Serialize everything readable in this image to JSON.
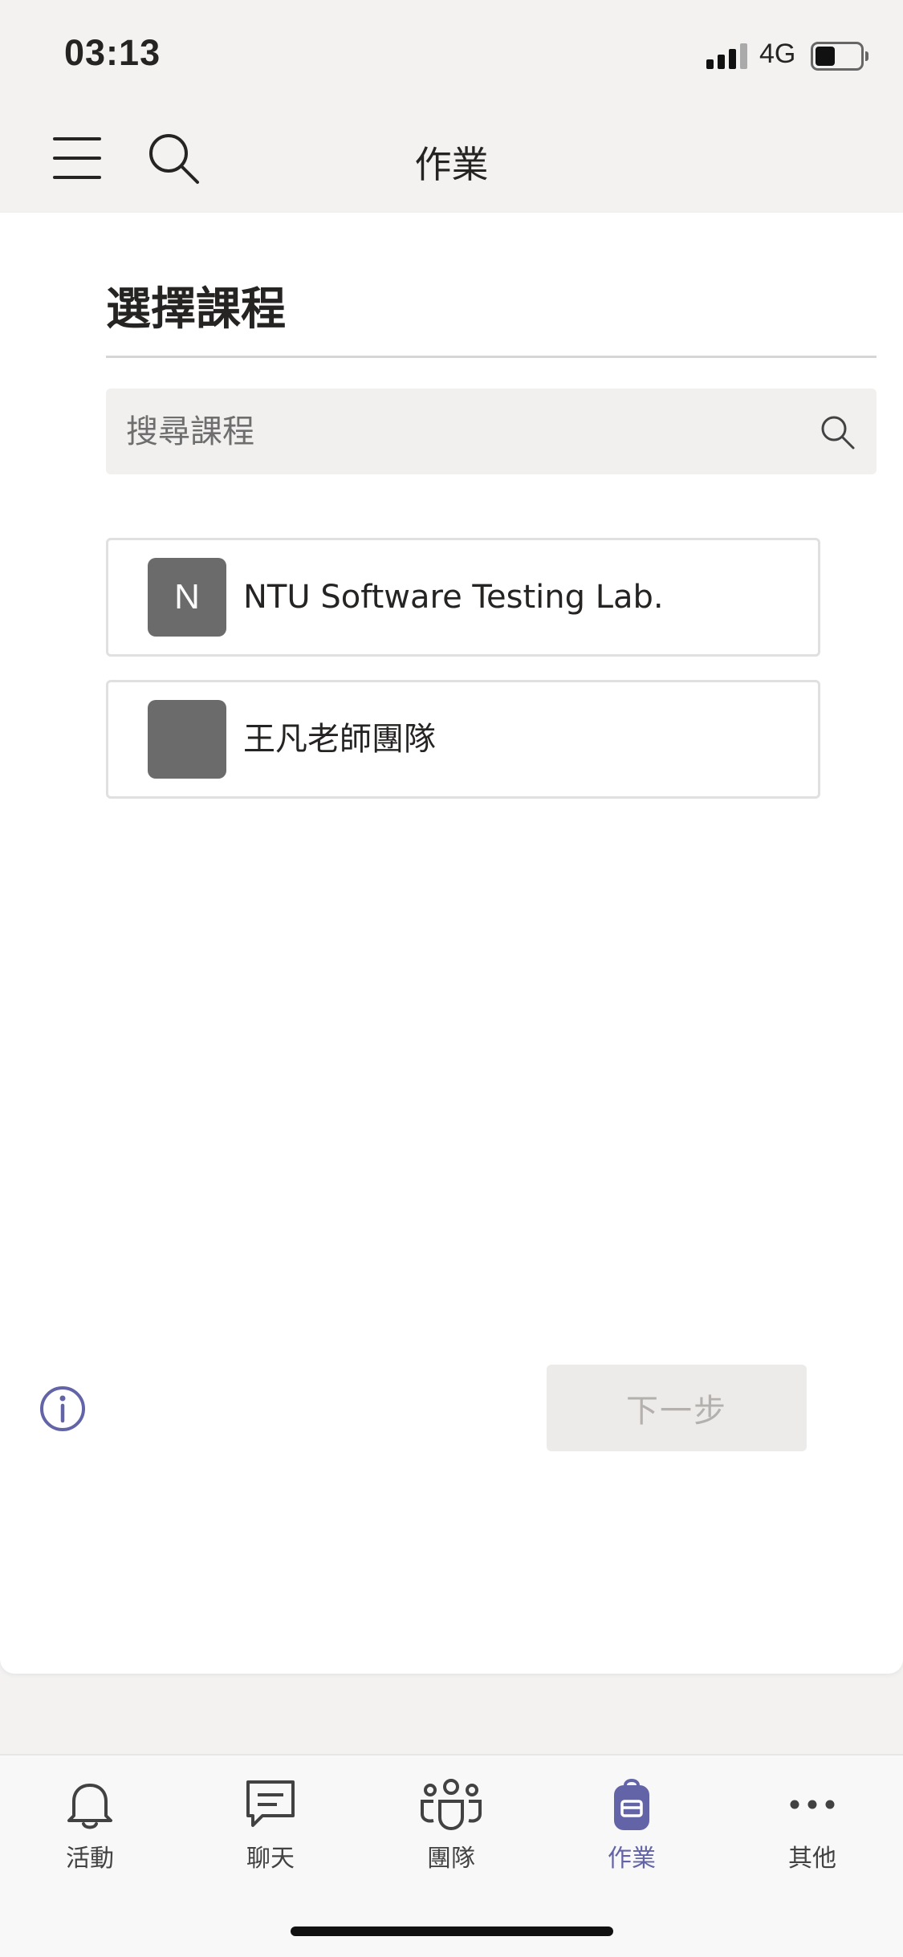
{
  "status_bar": {
    "time": "03:13",
    "network": "4G"
  },
  "header": {
    "title": "作業"
  },
  "panel": {
    "title": "選擇課程",
    "search_placeholder": "搜尋課程",
    "courses": [
      {
        "avatar_text": "N",
        "name": "NTU Software Testing Lab."
      },
      {
        "avatar_text": "",
        "name": "王凡老師團隊"
      }
    ],
    "next_button": "下一步"
  },
  "tab_bar": {
    "tabs": [
      {
        "label": "活動",
        "icon": "bell-icon"
      },
      {
        "label": "聊天",
        "icon": "chat-icon"
      },
      {
        "label": "團隊",
        "icon": "teams-icon"
      },
      {
        "label": "作業",
        "icon": "backpack-icon",
        "active": true
      },
      {
        "label": "其他",
        "icon": "more-icon"
      }
    ]
  },
  "colors": {
    "accent": "#6264a7",
    "avatar": "#6b6b6b",
    "disabled_text": "#b3b0ad"
  }
}
